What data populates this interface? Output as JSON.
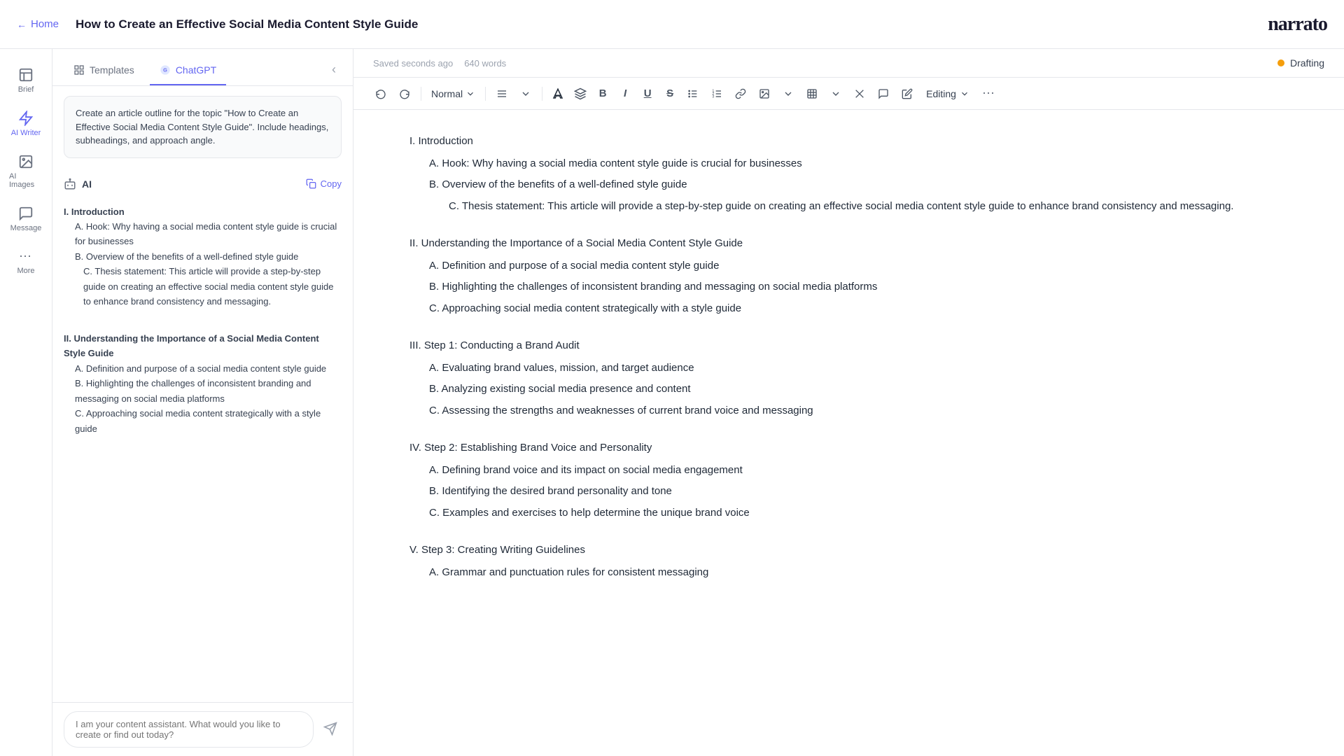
{
  "nav": {
    "home_label": "Home",
    "doc_title": "How to Create an Effective Social Media Content Style Guide",
    "brand_name": "narrato"
  },
  "sidebar": {
    "items": [
      {
        "id": "brief",
        "label": "Brief",
        "icon": "brief-icon"
      },
      {
        "id": "ai-writer",
        "label": "AI Writer",
        "icon": "ai-writer-icon"
      },
      {
        "id": "ai-images",
        "label": "AI Images",
        "icon": "ai-images-icon"
      },
      {
        "id": "message",
        "label": "Message",
        "icon": "message-icon"
      },
      {
        "id": "more",
        "label": "More",
        "icon": "more-icon"
      }
    ]
  },
  "panel": {
    "tabs": [
      {
        "id": "templates",
        "label": "Templates",
        "active": false
      },
      {
        "id": "chatgpt",
        "label": "ChatGPT",
        "active": true
      }
    ],
    "prompt": "Create an article outline for the topic \"How to Create an Effective Social Media Content Style Guide\". Include headings, subheadings, and approach angle.",
    "ai_label": "AI",
    "copy_label": "Copy",
    "outline": [
      {
        "level": "h1",
        "text": "I. Introduction"
      },
      {
        "level": "h2",
        "text": "A. Hook: Why having a social media content style guide is crucial for businesses"
      },
      {
        "level": "h2",
        "text": "B. Overview of the benefits of a well-defined style guide"
      },
      {
        "level": "h3",
        "text": "C. Thesis statement: This article will provide a step-by-step guide on creating an effective social media content style guide to enhance brand consistency and messaging."
      },
      {
        "level": "h1",
        "text": "II. Understanding the Importance of a Social Media Content Style Guide"
      },
      {
        "level": "h2",
        "text": "A. Definition and purpose of a social media content style guide"
      },
      {
        "level": "h2",
        "text": "B. Highlighting the challenges of inconsistent branding and messaging on social media platforms"
      },
      {
        "level": "h2",
        "text": "C. Approaching social media content strategically with a style guide"
      }
    ],
    "chat_placeholder": "I am your content assistant. What would you like to create or find out today?"
  },
  "editor": {
    "saved_text": "Saved seconds ago",
    "word_count": "640 words",
    "draft_label": "Drafting",
    "toolbar": {
      "undo": "↩",
      "redo": "↪",
      "style_label": "Normal",
      "editing_label": "Editing"
    },
    "content": {
      "sections": [
        {
          "h1": "I. Introduction",
          "items": [
            {
              "level": "h2",
              "text": "A. Hook: Why having a social media content style guide is crucial for businesses"
            },
            {
              "level": "h2",
              "text": "B. Overview of the benefits of a well-defined style guide"
            },
            {
              "level": "h3",
              "text": "C. Thesis statement: This article will provide a step-by-step guide on creating an effective social media content style guide to enhance brand consistency and messaging."
            }
          ]
        },
        {
          "h1": "II. Understanding the Importance of a Social Media Content Style Guide",
          "items": [
            {
              "level": "h2",
              "text": "A. Definition and purpose of a social media content style guide"
            },
            {
              "level": "h2",
              "text": "B. Highlighting the challenges of inconsistent branding and messaging on social media platforms"
            },
            {
              "level": "h2",
              "text": "C. Approaching social media content strategically with a style guide"
            }
          ]
        },
        {
          "h1": "III. Step 1: Conducting a Brand Audit",
          "items": [
            {
              "level": "h2",
              "text": "A. Evaluating brand values, mission, and target audience"
            },
            {
              "level": "h2",
              "text": "B. Analyzing existing social media presence and content"
            },
            {
              "level": "h2",
              "text": "C. Assessing the strengths and weaknesses of current brand voice and messaging"
            }
          ]
        },
        {
          "h1": "IV. Step 2: Establishing Brand Voice and Personality",
          "items": [
            {
              "level": "h2",
              "text": "A. Defining brand voice and its impact on social media engagement"
            },
            {
              "level": "h2",
              "text": "B. Identifying the desired brand personality and tone"
            },
            {
              "level": "h2",
              "text": "C. Examples and exercises to help determine the unique brand voice"
            }
          ]
        },
        {
          "h1": "V. Step 3: Creating Writing Guidelines",
          "items": [
            {
              "level": "h2",
              "text": "A. Grammar and punctuation rules for consistent messaging"
            }
          ]
        }
      ]
    }
  }
}
